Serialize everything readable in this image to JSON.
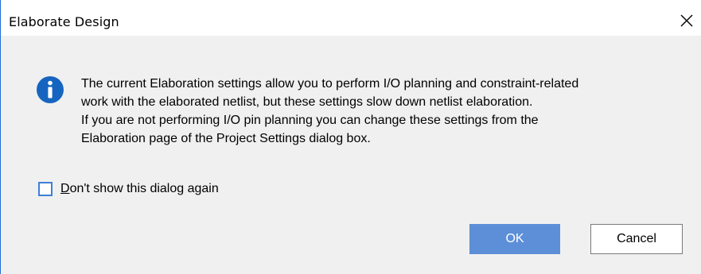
{
  "window": {
    "title": "Elaborate Design",
    "close_icon": "close-icon"
  },
  "message": {
    "icon": "info-icon",
    "lines": [
      "The current Elaboration settings allow you to perform I/O planning and constraint-related",
      "work with the elaborated netlist, but these settings slow down netlist elaboration.",
      "If you are not performing I/O pin planning you can change these settings from the",
      "Elaboration page of the Project Settings dialog box."
    ]
  },
  "checkbox": {
    "label_mnemonic": "D",
    "label_rest": "on't show this dialog again",
    "checked": false
  },
  "buttons": {
    "ok_label": "OK",
    "cancel_label": "Cancel"
  },
  "colors": {
    "info_icon": "#1565c0",
    "ok_button": "#5d8fd8",
    "checkbox_border": "#3f7fd6",
    "dialog_bg": "#f0f0f0"
  }
}
